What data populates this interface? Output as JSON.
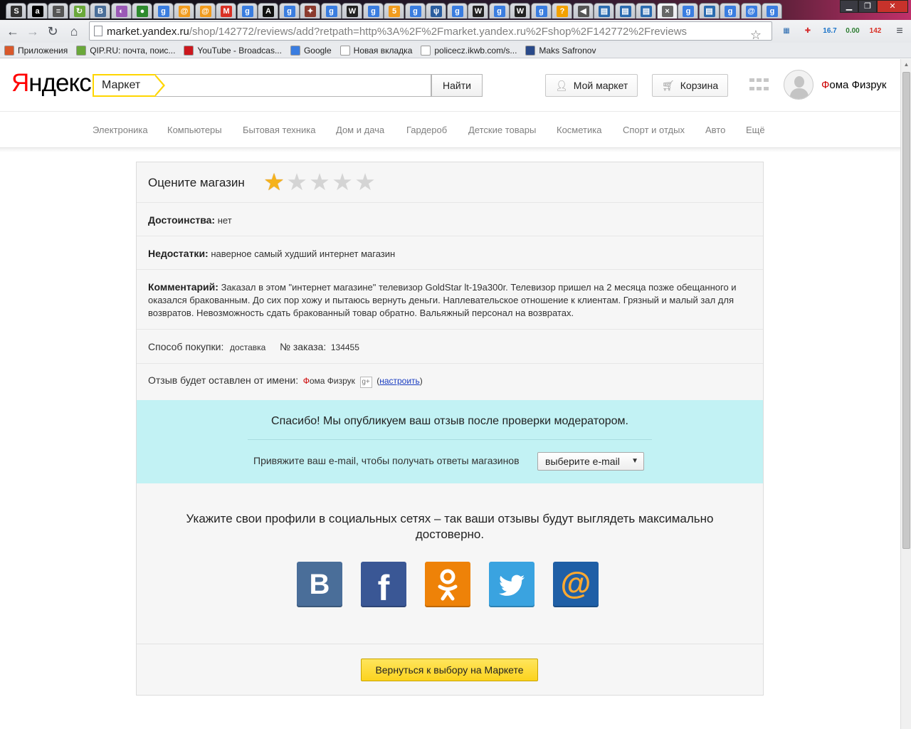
{
  "browser": {
    "tab_favicons": [
      {
        "glyph": "S",
        "color": "#333333"
      },
      {
        "glyph": "a",
        "color": "#000000"
      },
      {
        "glyph": "≡",
        "color": "#555555"
      },
      {
        "glyph": "↻",
        "color": "#6aa83a"
      },
      {
        "glyph": "B",
        "color": "#4a6e99"
      },
      {
        "glyph": "◐",
        "color": "#9b59b6"
      },
      {
        "glyph": "●",
        "color": "#2e8b2e"
      },
      {
        "glyph": "g",
        "color": "#3a7de0"
      },
      {
        "glyph": "@",
        "color": "#f29b1d"
      },
      {
        "glyph": "@",
        "color": "#f29b1d"
      },
      {
        "glyph": "M",
        "color": "#d93025"
      },
      {
        "glyph": "g",
        "color": "#3a7de0"
      },
      {
        "glyph": "A",
        "color": "#111111"
      },
      {
        "glyph": "g",
        "color": "#3a7de0"
      },
      {
        "glyph": "✦",
        "color": "#8b3a2e"
      },
      {
        "glyph": "g",
        "color": "#3a7de0"
      },
      {
        "glyph": "W",
        "color": "#222222"
      },
      {
        "glyph": "g",
        "color": "#3a7de0"
      },
      {
        "glyph": "5",
        "color": "#f29b1d"
      },
      {
        "glyph": "g",
        "color": "#3a7de0"
      },
      {
        "glyph": "ψ",
        "color": "#2a5d9f"
      },
      {
        "glyph": "g",
        "color": "#3a7de0"
      },
      {
        "glyph": "W",
        "color": "#222222"
      },
      {
        "glyph": "g",
        "color": "#3a7de0"
      },
      {
        "glyph": "W",
        "color": "#222222"
      },
      {
        "glyph": "g",
        "color": "#3a7de0"
      },
      {
        "glyph": "?",
        "color": "#f2a100"
      },
      {
        "glyph": "◀",
        "color": "#555555"
      },
      {
        "glyph": "▤",
        "color": "#2a6bb0"
      },
      {
        "glyph": "▤",
        "color": "#2a6bb0"
      },
      {
        "glyph": "▤",
        "color": "#2a6bb0"
      },
      {
        "glyph": "×",
        "color": "#666666"
      },
      {
        "glyph": "g",
        "color": "#3a7de0"
      },
      {
        "glyph": "▤",
        "color": "#2a6bb0"
      },
      {
        "glyph": "g",
        "color": "#3a7de0"
      },
      {
        "glyph": "@",
        "color": "#3a7de0"
      },
      {
        "glyph": "g",
        "color": "#3a7de0"
      }
    ],
    "active_tab_index": 31,
    "url_host": "market.yandex.ru",
    "url_path": "/shop/142772/reviews/add?retpath=http%3A%2F%2Fmarket.yandex.ru%2Fshop%2F142772%2Freviews",
    "extensions": [
      {
        "text": "▦",
        "color": "#2a6bb0"
      },
      {
        "text": "✚",
        "color": "#d42a2a"
      },
      {
        "text": "16.7",
        "color": "#1a73c8"
      },
      {
        "text": "0.00",
        "color": "#2e7d32"
      },
      {
        "text": "142",
        "color": "#d93025"
      }
    ],
    "bookmarks": [
      {
        "label": "Приложения",
        "icon_color": "#d9582b"
      },
      {
        "label": "QIP.RU: почта, поис...",
        "icon_color": "#6aa83a"
      },
      {
        "label": "YouTube - Broadcas...",
        "icon_color": "#cc181e"
      },
      {
        "label": "Google",
        "icon_color": "#3a7de0"
      },
      {
        "label": "Новая вкладка",
        "icon_color": "#ffffff"
      },
      {
        "label": "policecz.ikwb.com/s...",
        "icon_color": "#ffffff"
      },
      {
        "label": "Maks Safronov",
        "icon_color": "#2a4a8a"
      }
    ]
  },
  "header": {
    "logo_first": "Я",
    "logo_rest": "ндекс",
    "search_service": "Маркет",
    "search_value": "",
    "search_button": "Найти",
    "my_market": "Мой маркет",
    "cart": "Корзина",
    "user_first": "Ф",
    "user_rest": "ома Физрук"
  },
  "categories": [
    "Электроника",
    "Компьютеры",
    "Бытовая техника",
    "Дом и дача",
    "Гардероб",
    "Детские товары",
    "Косметика",
    "Спорт и отдых",
    "Авто",
    "Ещё"
  ],
  "review": {
    "rate_title": "Оцените магазин",
    "rating": 1,
    "rating_max": 5,
    "pros_label": "Достоинства:",
    "pros_value": "нет",
    "cons_label": "Недостатки:",
    "cons_value": "наверное самый худший интернет магазин",
    "comment_label": "Комментарий:",
    "comment_value": "Заказал в этом \"интернет магазине\" телевизор GoldStar lt-19a300r. Телевизор пришел на 2 месяца позже обещанного и оказался бракованным. До сих пор хожу и пытаюсь вернуть деньги. Наплевательское отношение к клиентам. Грязный и малый зал для возвратов. Невозможность сдать бракованный товар обратно. Вальяжный персонал на возвратах.",
    "purchase_label": "Способ покупки:",
    "purchase_value": "доставка",
    "order_label": "№ заказа:",
    "order_value": "134455",
    "author_label": "Отзыв будет оставлен от имени:",
    "author_first": "Ф",
    "author_rest": "ома Физрук",
    "author_badge": "g+",
    "configure_open": "(",
    "configure_link": "настроить",
    "configure_close": ")"
  },
  "thanks": {
    "message": "Спасибо! Мы опубликуем ваш отзыв после проверки модератором.",
    "email_label": "Привяжите ваш e-mail, чтобы получать ответы магазинов",
    "email_select": "выберите e-mail"
  },
  "social": {
    "text": "Укажите свои профили в социальных сетях – так ваши отзывы будут выглядеть максимально достоверно.",
    "networks": [
      {
        "name": "vk",
        "glyph": "B"
      },
      {
        "name": "facebook",
        "glyph": "f"
      },
      {
        "name": "odnoklassniki",
        "glyph": "ok"
      },
      {
        "name": "twitter",
        "glyph": "t"
      },
      {
        "name": "mail",
        "glyph": "@"
      }
    ]
  },
  "back_button": "Вернуться к выбору на Маркете"
}
